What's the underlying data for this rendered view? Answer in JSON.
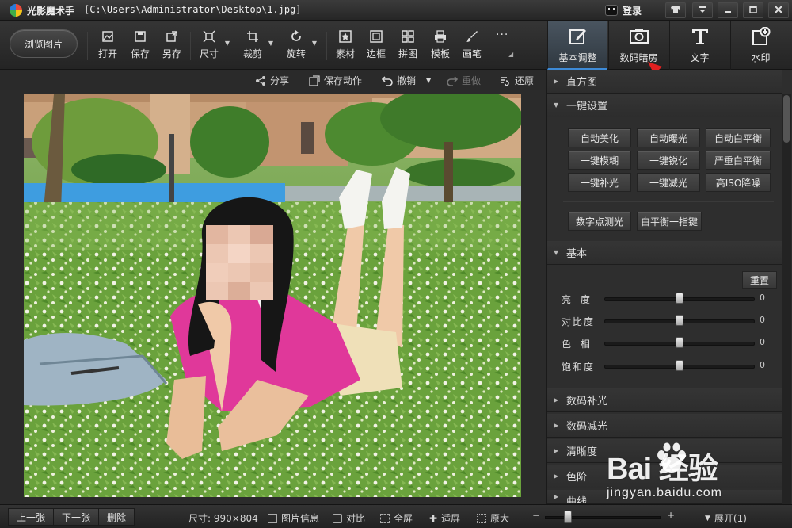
{
  "app": {
    "title": "光影魔术手",
    "path": "[C:\\Users\\Administrator\\Desktop\\1.jpg]",
    "login_label": "登录"
  },
  "toolbar": {
    "browse_label": "浏览图片",
    "tools": [
      {
        "label": "打开",
        "icon": "open-image-icon"
      },
      {
        "label": "保存",
        "icon": "save-icon"
      },
      {
        "label": "另存",
        "icon": "save-as-icon"
      },
      {
        "label": "尺寸",
        "icon": "resize-icon"
      },
      {
        "label": "裁剪",
        "icon": "crop-icon"
      },
      {
        "label": "旋转",
        "icon": "rotate-icon"
      },
      {
        "label": "素材",
        "icon": "material-icon"
      },
      {
        "label": "边框",
        "icon": "border-icon"
      },
      {
        "label": "拼图",
        "icon": "collage-icon"
      },
      {
        "label": "模板",
        "icon": "print-template-icon"
      },
      {
        "label": "画笔",
        "icon": "brush-icon"
      }
    ],
    "more_label": "···"
  },
  "module_tabs": [
    {
      "label": "基本调整",
      "icon": "basic-adjust-icon",
      "active": true
    },
    {
      "label": "数码暗房",
      "icon": "darkroom-camera-icon",
      "active": false
    },
    {
      "label": "文字",
      "icon": "text-icon",
      "active": false
    },
    {
      "label": "水印",
      "icon": "watermark-icon",
      "active": false
    }
  ],
  "actions": {
    "share": "分享",
    "save_action": "保存动作",
    "undo": "撤销",
    "redo": "重做",
    "restore": "还原"
  },
  "panel": {
    "histogram": "直方图",
    "one_click": "一键设置",
    "presets": [
      "自动美化",
      "自动曝光",
      "自动白平衡",
      "一键模糊",
      "一键锐化",
      "严重白平衡",
      "一键补光",
      "一键减光",
      "高ISO降噪"
    ],
    "presets_extra": [
      "数字点测光",
      "白平衡一指键"
    ],
    "basic": "基本",
    "reset": "重置",
    "sliders": [
      {
        "label": "亮  度",
        "value": "0",
        "level": 0.5
      },
      {
        "label": "对比度",
        "value": "0",
        "level": 0.5
      },
      {
        "label": "色  相",
        "value": "0",
        "level": 0.5
      },
      {
        "label": "饱和度",
        "value": "0",
        "level": 0.5
      }
    ],
    "collapsed": [
      "数码补光",
      "数码减光",
      "清晰度",
      "色阶",
      "曲线"
    ]
  },
  "status": {
    "prev": "上一张",
    "next": "下一张",
    "delete": "删除",
    "size": "尺寸: 990×804",
    "info": "图片信息",
    "compare": "对比",
    "fullscreen": "全屏",
    "fit": "适屏",
    "original": "原大",
    "zoom_level": 0.2,
    "expand": "展开(1)"
  },
  "watermark": {
    "brand": "Bai  经验",
    "url": "jingyan.baidu.com"
  },
  "colors": {
    "accent": "#3d8bd8",
    "annotation_arrow": "#e02020",
    "photo_shirt": "#e0389a"
  }
}
